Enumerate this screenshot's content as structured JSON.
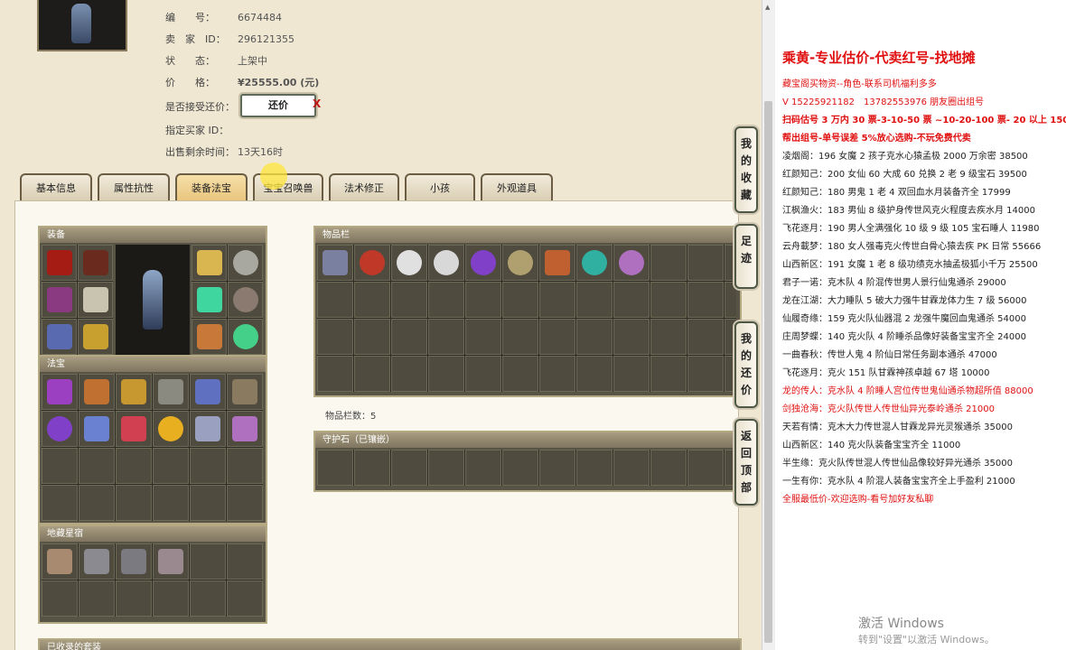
{
  "info": {
    "id_label": "编　　号：",
    "id_value": "6674484",
    "seller_label": "卖　家　ID：",
    "seller_value": "296121355",
    "status_label": "状　　态：",
    "status_value": "上架中",
    "price_label": "价　　格：",
    "price_value": "¥25555.00 (元)",
    "counter_label": "是否接受还价：",
    "counter_button": "还价",
    "counter_x": "X",
    "buyer_label": "指定买家 ID：",
    "remain_label": "出售剩余时间：",
    "remain_value": "13天16时"
  },
  "tabs": [
    {
      "label": "基本信息"
    },
    {
      "label": "属性抗性"
    },
    {
      "label": "装备法宝"
    },
    {
      "label": "宝宝召唤兽"
    },
    {
      "label": "法术修正"
    },
    {
      "label": "小孩"
    },
    {
      "label": "外观道具"
    }
  ],
  "sections": {
    "equip": "装备",
    "fabao": "法宝",
    "dizang": "地藏星宿",
    "goods": "物品栏",
    "goods_count": "物品栏数：5",
    "guard": "守护石（已镶嵌）",
    "collected": "已收录的套装"
  },
  "side_buttons": [
    "我的收藏",
    "足迹",
    "我的还价",
    "返回顶部"
  ],
  "notes": [
    {
      "text": "乘黄-专业估价-代卖红号-找地摊",
      "style": "title"
    },
    {
      "text": "藏宝阁买物资--角色-联系司机福利多多",
      "style": "red"
    },
    {
      "text": "V 15225921182　13782553976 朋友圈出组号",
      "style": "red"
    },
    {
      "text": "扫码估号 3 万内 30 票-3-10-50 票 ~10-20-100 票- 20 以上 150",
      "style": "redbold"
    },
    {
      "text": "帮出组号-单号误差 5%放心选购-不玩免费代卖",
      "style": "redbold"
    },
    {
      "text": "凌烟阁：196 女魔 2 孩子克水心猿孟极 2000 万余密 38500",
      "style": ""
    },
    {
      "text": "红颜知己：200 女仙 60 大成 60 兑换 2 老 9 级宝石 39500",
      "style": ""
    },
    {
      "text": "红颜知己：180 男鬼 1 老 4 双回血水月装备齐全 17999",
      "style": ""
    },
    {
      "text": "江枫渔火：183 男仙 8 级护身传世风克火程度去疾水月 14000",
      "style": ""
    },
    {
      "text": "飞花逐月：190 男人全满强化 10 级 9 级 105 宝石睡人 11980",
      "style": ""
    },
    {
      "text": "云舟載梦：180 女人强毒克火传世白骨心猿去疾 PK 日常 55666",
      "style": ""
    },
    {
      "text": "山西新区：191 女魔 1 老 8 级功绩克水抽孟极狐小千万 25500",
      "style": ""
    },
    {
      "text": "君子一诺：克木队 4 阶混传世男人景行仙鬼通杀 29000",
      "style": ""
    },
    {
      "text": "龙在江湖：大力睡队 5 破大力强牛甘霖龙体力生 7 级 56000",
      "style": ""
    },
    {
      "text": "仙履奇缘：159 克火队仙器混 2 龙强牛魔回血鬼通杀 54000",
      "style": ""
    },
    {
      "text": "庄周梦蝶：140 克火队 4 阶睡杀品像好装备宝宝齐全 24000",
      "style": ""
    },
    {
      "text": "一曲春秋：传世人鬼 4 阶仙日常任务副本通杀 47000",
      "style": ""
    },
    {
      "text": "飞花逐月：克火 151 队甘霖神孩卓越 67 塔 10000",
      "style": ""
    },
    {
      "text": "龙的传人：克水队 4 阶睡人宫位传世鬼仙通杀物超所值 88000",
      "style": "red"
    },
    {
      "text": "剑独沧海：克火队传世人传世仙异光泰岭通杀 21000",
      "style": "red"
    },
    {
      "text": "天若有情：克木大力传世混人甘霖龙异光灵猴通杀 35000",
      "style": ""
    },
    {
      "text": "山西新区：140 克火队装备宝宝齐全 11000",
      "style": ""
    },
    {
      "text": "半生缘：克火队传世混人传世仙品像较好异光通杀 35000",
      "style": ""
    },
    {
      "text": "一生有你：克水队 4 阶混人装备宝宝齐全上手盈利 21000",
      "style": ""
    },
    {
      "text": "全服最低价-欢迎选购-看号加好友私聊",
      "style": "red"
    }
  ],
  "watermark": {
    "line1": "激活 Windows",
    "line2": "转到\"设置\"以激活 Windows。"
  },
  "colors": {
    "price": "#d01010",
    "accent": "#e01010"
  }
}
